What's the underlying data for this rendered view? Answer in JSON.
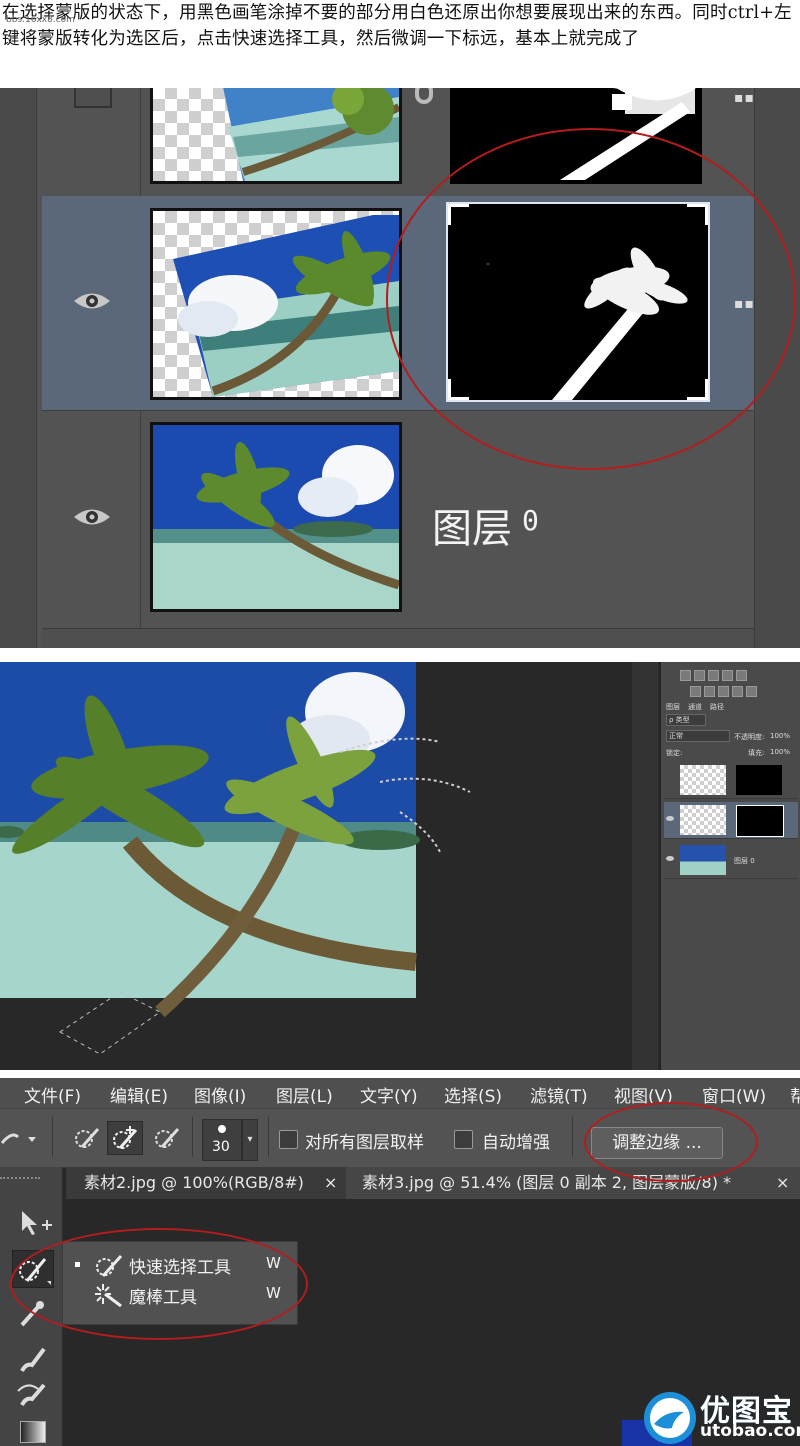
{
  "intro": {
    "text": "在选择蒙版的状态下，用黑色画笔涂掉不要的部分用白色还原出你想要展现出来的东西。同时ctrl+左键将蒙版转化为选区后，点击快速选择工具，然后微调一下标远，基本上就完成了",
    "watermark": "bbs.16xx8.com"
  },
  "layers_zoom": {
    "layer0_name": "图层",
    "layer0_num": "0"
  },
  "mini_panel": {
    "tabs": [
      "图层",
      "通道",
      "路径"
    ],
    "kind_label": "ρ 类型",
    "blend_mode": "正常",
    "opacity_label": "不透明度:",
    "opacity_value": "100%",
    "lock_label": "锁定:",
    "fill_label": "填充:",
    "fill_value": "100%",
    "layer0_label": "图层 0"
  },
  "menubar": {
    "items": [
      "文件(F)",
      "编辑(E)",
      "图像(I)",
      "图层(L)",
      "文字(Y)",
      "选择(S)",
      "滤镜(T)",
      "视图(V)",
      "窗口(W)",
      "帮"
    ]
  },
  "options": {
    "brush_size": "30",
    "sample_all_label": "对所有图层取样",
    "auto_enhance_label": "自动增强",
    "refine_edge_label": "调整边缘 ..."
  },
  "tabs": {
    "tab1": "素材2.jpg @ 100%(RGB/8#)",
    "tab1_close": "×",
    "tab2": "素材3.jpg @ 51.4% (图层 0 副本 2, 图层蒙版/8) *",
    "tab2_close": "×"
  },
  "flyout": {
    "items": [
      {
        "label": "快速选择工具",
        "key": "W"
      },
      {
        "label": "魔棒工具",
        "key": "W"
      }
    ]
  },
  "logo": {
    "cn": "优图宝",
    "url": "utobao.com"
  },
  "colors": {
    "annotation_red": "#b31d1d",
    "selected_layer": "#5b687a",
    "panel_gray": "#535353"
  }
}
